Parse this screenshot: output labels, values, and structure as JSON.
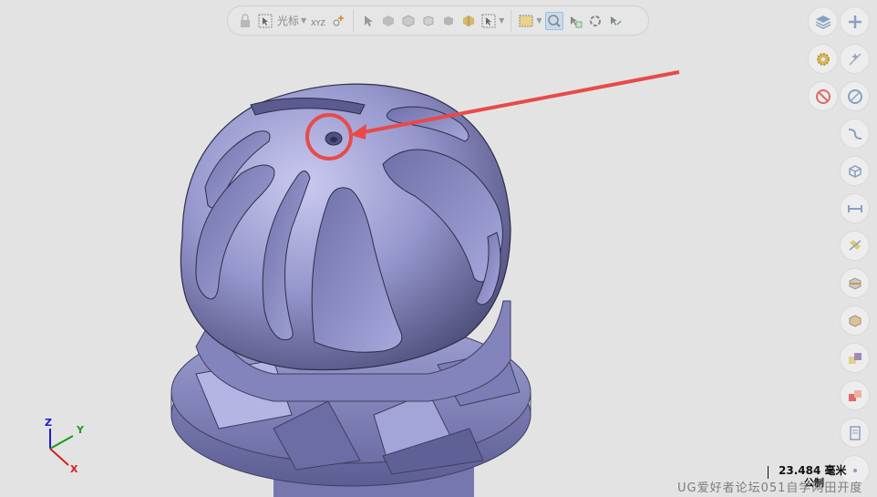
{
  "toolbar": {
    "cursor_label": "光标",
    "items": [
      "lock-icon",
      "select-cursor-icon",
      "xyz-icon",
      "point-snap-icon",
      "arrow-icon",
      "face-icon",
      "body-icon",
      "feature-icon",
      "solid-icon",
      "component-icon",
      "selection-filter-icon",
      "box-select-icon",
      "zoom-select-icon",
      "select-face-icon",
      "rotate-icon",
      "back-arrow-icon"
    ]
  },
  "right_rail": {
    "buttons": [
      "layers-icon",
      "add-icon",
      "settings-gear-icon",
      "snap-point-icon",
      "no-select-icon",
      "circle-icon",
      "curve-icon",
      "view-cube-icon",
      "measure-distance-icon",
      "measure-angle-icon",
      "section-view-icon",
      "shaded-view-icon",
      "color-swatch-icon",
      "color-swatch-red-icon",
      "document-icon",
      "more-icon"
    ]
  },
  "triad": {
    "x_label": "X",
    "y_label": "Y",
    "z_label": "Z"
  },
  "scale_bar": {
    "value": "23.484 毫米",
    "unit": "公制"
  },
  "watermark": "UG爱好者论坛051自学网田开度",
  "colors": {
    "background": "#e3e3e3",
    "model": "#8e8fc4",
    "annotation_red": "#e84a4a",
    "axis_x": "#d42020",
    "axis_y": "#1a9a1a",
    "axis_z": "#1a1ad4"
  }
}
